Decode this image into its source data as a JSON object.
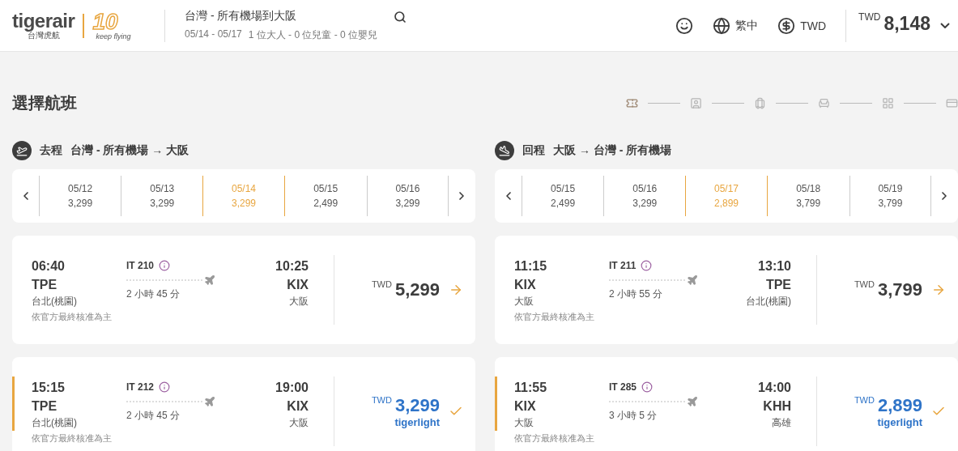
{
  "header": {
    "logo": {
      "wordmark": "tigerair",
      "subtitle": "台灣虎航",
      "badge_number": "10",
      "badge_tagline": "keep flying"
    },
    "search": {
      "route": "台灣 - 所有機場到大阪",
      "dates": "05/14 - 05/17",
      "passengers": "1 位大人 - 0 位兒童 - 0 位嬰兒"
    },
    "language": "繁中",
    "currency": "TWD",
    "total": {
      "currency": "TWD",
      "amount": "8,148"
    }
  },
  "page_title": "選擇航班",
  "steps": [
    {
      "kind": "ticket",
      "selected": true
    },
    {
      "kind": "passenger",
      "selected": false
    },
    {
      "kind": "baggage",
      "selected": false
    },
    {
      "kind": "seat",
      "selected": false
    },
    {
      "kind": "extras",
      "selected": false
    },
    {
      "kind": "payment",
      "selected": false
    }
  ],
  "legs": [
    {
      "kind": "outbound",
      "direction": "去程",
      "route": "台灣 - 所有機場 → 大阪",
      "dates": [
        {
          "date": "05/12",
          "price": "3,299",
          "selected": false
        },
        {
          "date": "05/13",
          "price": "3,299",
          "selected": false
        },
        {
          "date": "05/14",
          "price": "3,299",
          "selected": true
        },
        {
          "date": "05/15",
          "price": "2,499",
          "selected": false
        },
        {
          "date": "05/16",
          "price": "3,299",
          "selected": false
        }
      ],
      "flights": [
        {
          "depart_time": "06:40",
          "depart_code": "TPE",
          "depart_city": "台北(桃園)",
          "flight_no": "IT 210",
          "duration": "2 小時 45 分",
          "arrive_time": "10:25",
          "arrive_code": "KIX",
          "arrive_city": "大阪",
          "note": "依官方最終核准為主",
          "currency": "TWD",
          "price": "5,299",
          "selected": false
        },
        {
          "depart_time": "15:15",
          "depart_code": "TPE",
          "depart_city": "台北(桃園)",
          "flight_no": "IT 212",
          "duration": "2 小時 45 分",
          "arrive_time": "19:00",
          "arrive_code": "KIX",
          "arrive_city": "大阪",
          "note": "依官方最終核准為主",
          "currency": "TWD",
          "price": "3,299",
          "fare": "tigerlight",
          "selected": true
        }
      ]
    },
    {
      "kind": "return",
      "direction": "回程",
      "route": "大阪 → 台灣 - 所有機場",
      "dates": [
        {
          "date": "05/15",
          "price": "2,499",
          "selected": false
        },
        {
          "date": "05/16",
          "price": "3,299",
          "selected": false
        },
        {
          "date": "05/17",
          "price": "2,899",
          "selected": true
        },
        {
          "date": "05/18",
          "price": "3,799",
          "selected": false
        },
        {
          "date": "05/19",
          "price": "3,799",
          "selected": false
        }
      ],
      "flights": [
        {
          "depart_time": "11:15",
          "depart_code": "KIX",
          "depart_city": "大阪",
          "flight_no": "IT 211",
          "duration": "2 小時 55 分",
          "arrive_time": "13:10",
          "arrive_code": "TPE",
          "arrive_city": "台北(桃園)",
          "note": "依官方最終核准為主",
          "currency": "TWD",
          "price": "3,799",
          "selected": false
        },
        {
          "depart_time": "11:55",
          "depart_code": "KIX",
          "depart_city": "大阪",
          "flight_no": "IT 285",
          "duration": "3 小時 5 分",
          "arrive_time": "14:00",
          "arrive_code": "KHH",
          "arrive_city": "高雄",
          "note": "依官方最終核准為主",
          "currency": "TWD",
          "price": "2,899",
          "fare": "tigerlight",
          "selected": true
        }
      ]
    }
  ]
}
